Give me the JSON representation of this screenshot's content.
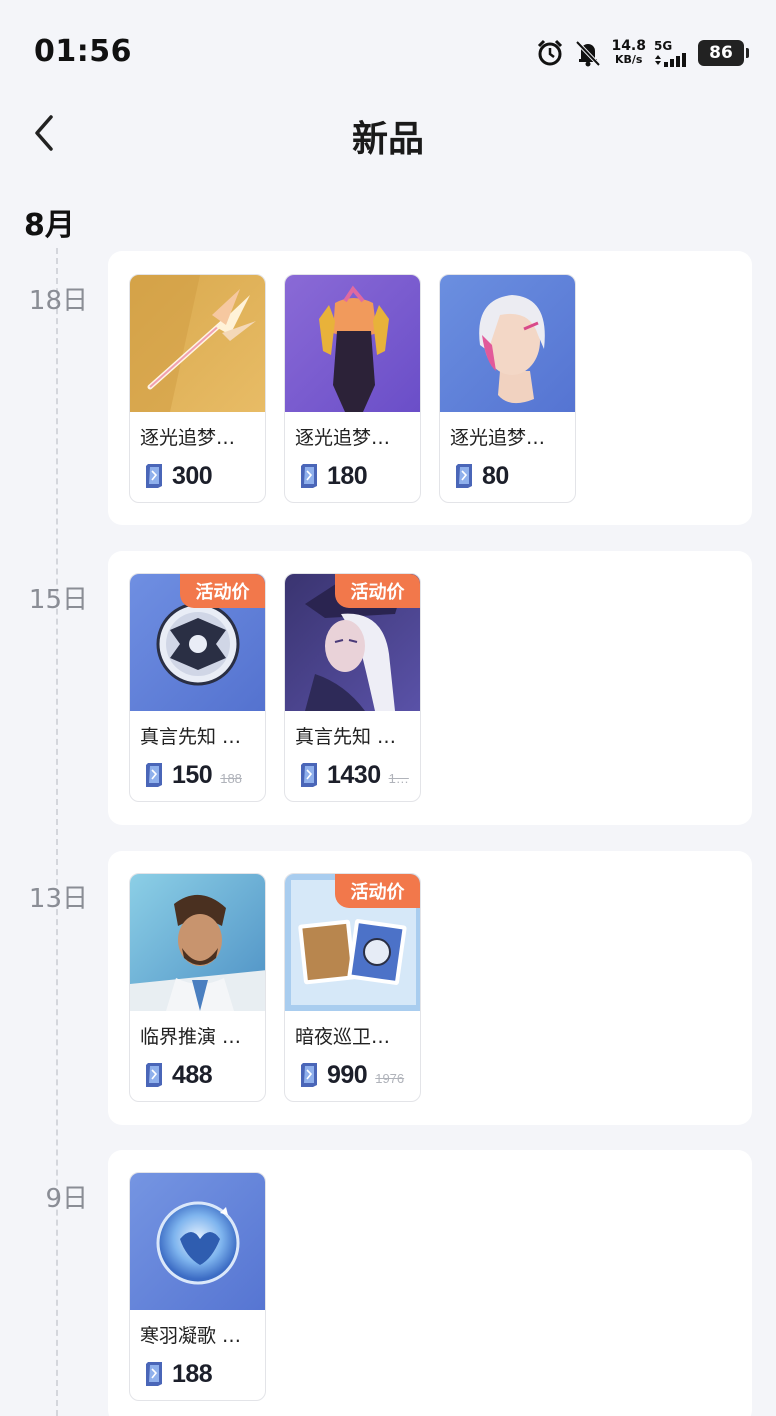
{
  "status_bar": {
    "time": "01:56",
    "speed_value": "14.8",
    "speed_unit": "KB/s",
    "network": "5G",
    "battery": "86"
  },
  "header": {
    "title": "新品"
  },
  "month": "8月",
  "badge_text": "活动价",
  "groups": [
    {
      "day": "18日",
      "items": [
        {
          "name": "逐光追梦…",
          "price": "300",
          "icon": "golden-spear-image"
        },
        {
          "name": "逐光追梦…",
          "price": "180",
          "icon": "outfit-image"
        },
        {
          "name": "逐光追梦…",
          "price": "80",
          "icon": "hair-avatar-image"
        }
      ]
    },
    {
      "day": "15日",
      "items": [
        {
          "name": "真言先知 …",
          "price": "150",
          "original_price": "188",
          "promo": true,
          "icon": "emblem-image"
        },
        {
          "name": "真言先知 …",
          "price": "1430",
          "original_price": "1…",
          "promo": true,
          "icon": "hero-skin-image"
        }
      ]
    },
    {
      "day": "13日",
      "items": [
        {
          "name": "临界推演 …",
          "price": "488",
          "icon": "hero-portrait-image"
        },
        {
          "name": "暗夜巡卫…",
          "price": "990",
          "original_price": "1976",
          "promo": true,
          "icon": "bundle-image"
        }
      ]
    },
    {
      "day": "9日",
      "items": [
        {
          "name": "寒羽凝歌 …",
          "price": "188",
          "icon": "orb-image"
        }
      ]
    }
  ],
  "colors": {
    "background": "#f4f5f9",
    "badge": "#f2784b",
    "card": "#ffffff",
    "day_label": "#8a8d95"
  }
}
